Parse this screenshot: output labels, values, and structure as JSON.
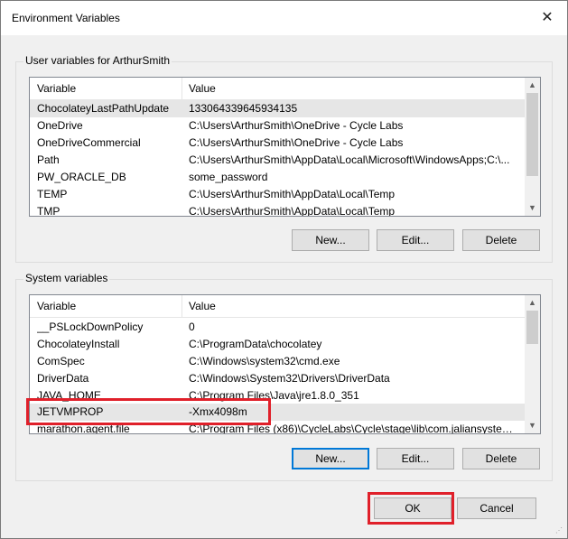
{
  "window": {
    "title": "Environment Variables",
    "close_glyph": "✕"
  },
  "user_vars": {
    "group_label": "User variables for ArthurSmith",
    "col_variable": "Variable",
    "col_value": "Value",
    "rows": [
      {
        "name": "ChocolateyLastPathUpdate",
        "value": "133064339645934135"
      },
      {
        "name": "OneDrive",
        "value": "C:\\Users\\ArthurSmith\\OneDrive - Cycle Labs"
      },
      {
        "name": "OneDriveCommercial",
        "value": "C:\\Users\\ArthurSmith\\OneDrive - Cycle Labs"
      },
      {
        "name": "Path",
        "value": "C:\\Users\\ArthurSmith\\AppData\\Local\\Microsoft\\WindowsApps;C:\\..."
      },
      {
        "name": "PW_ORACLE_DB",
        "value": "some_password"
      },
      {
        "name": "TEMP",
        "value": "C:\\Users\\ArthurSmith\\AppData\\Local\\Temp"
      },
      {
        "name": "TMP",
        "value": "C:\\Users\\ArthurSmith\\AppData\\Local\\Temp"
      }
    ],
    "new_label": "New...",
    "edit_label": "Edit...",
    "delete_label": "Delete"
  },
  "system_vars": {
    "group_label": "System variables",
    "col_variable": "Variable",
    "col_value": "Value",
    "rows": [
      {
        "name": "__PSLockDownPolicy",
        "value": "0"
      },
      {
        "name": "ChocolateyInstall",
        "value": "C:\\ProgramData\\chocolatey"
      },
      {
        "name": "ComSpec",
        "value": "C:\\Windows\\system32\\cmd.exe"
      },
      {
        "name": "DriverData",
        "value": "C:\\Windows\\System32\\Drivers\\DriverData"
      },
      {
        "name": "JAVA_HOME",
        "value": "C:\\Program Files\\Java\\jre1.8.0_351"
      },
      {
        "name": "JETVMPROP",
        "value": "-Xmx4098m"
      },
      {
        "name": "marathon.agent.file",
        "value": "C:\\Program Files (x86)\\CycleLabs\\Cycle\\stage\\lib\\com.jaliansystem..."
      }
    ],
    "new_label": "New...",
    "edit_label": "Edit...",
    "delete_label": "Delete"
  },
  "footer": {
    "ok_label": "OK",
    "cancel_label": "Cancel"
  },
  "colors": {
    "highlight_box": "#e0202a",
    "selected_row": "#e6e6e6",
    "focus_border": "#0078d7"
  }
}
